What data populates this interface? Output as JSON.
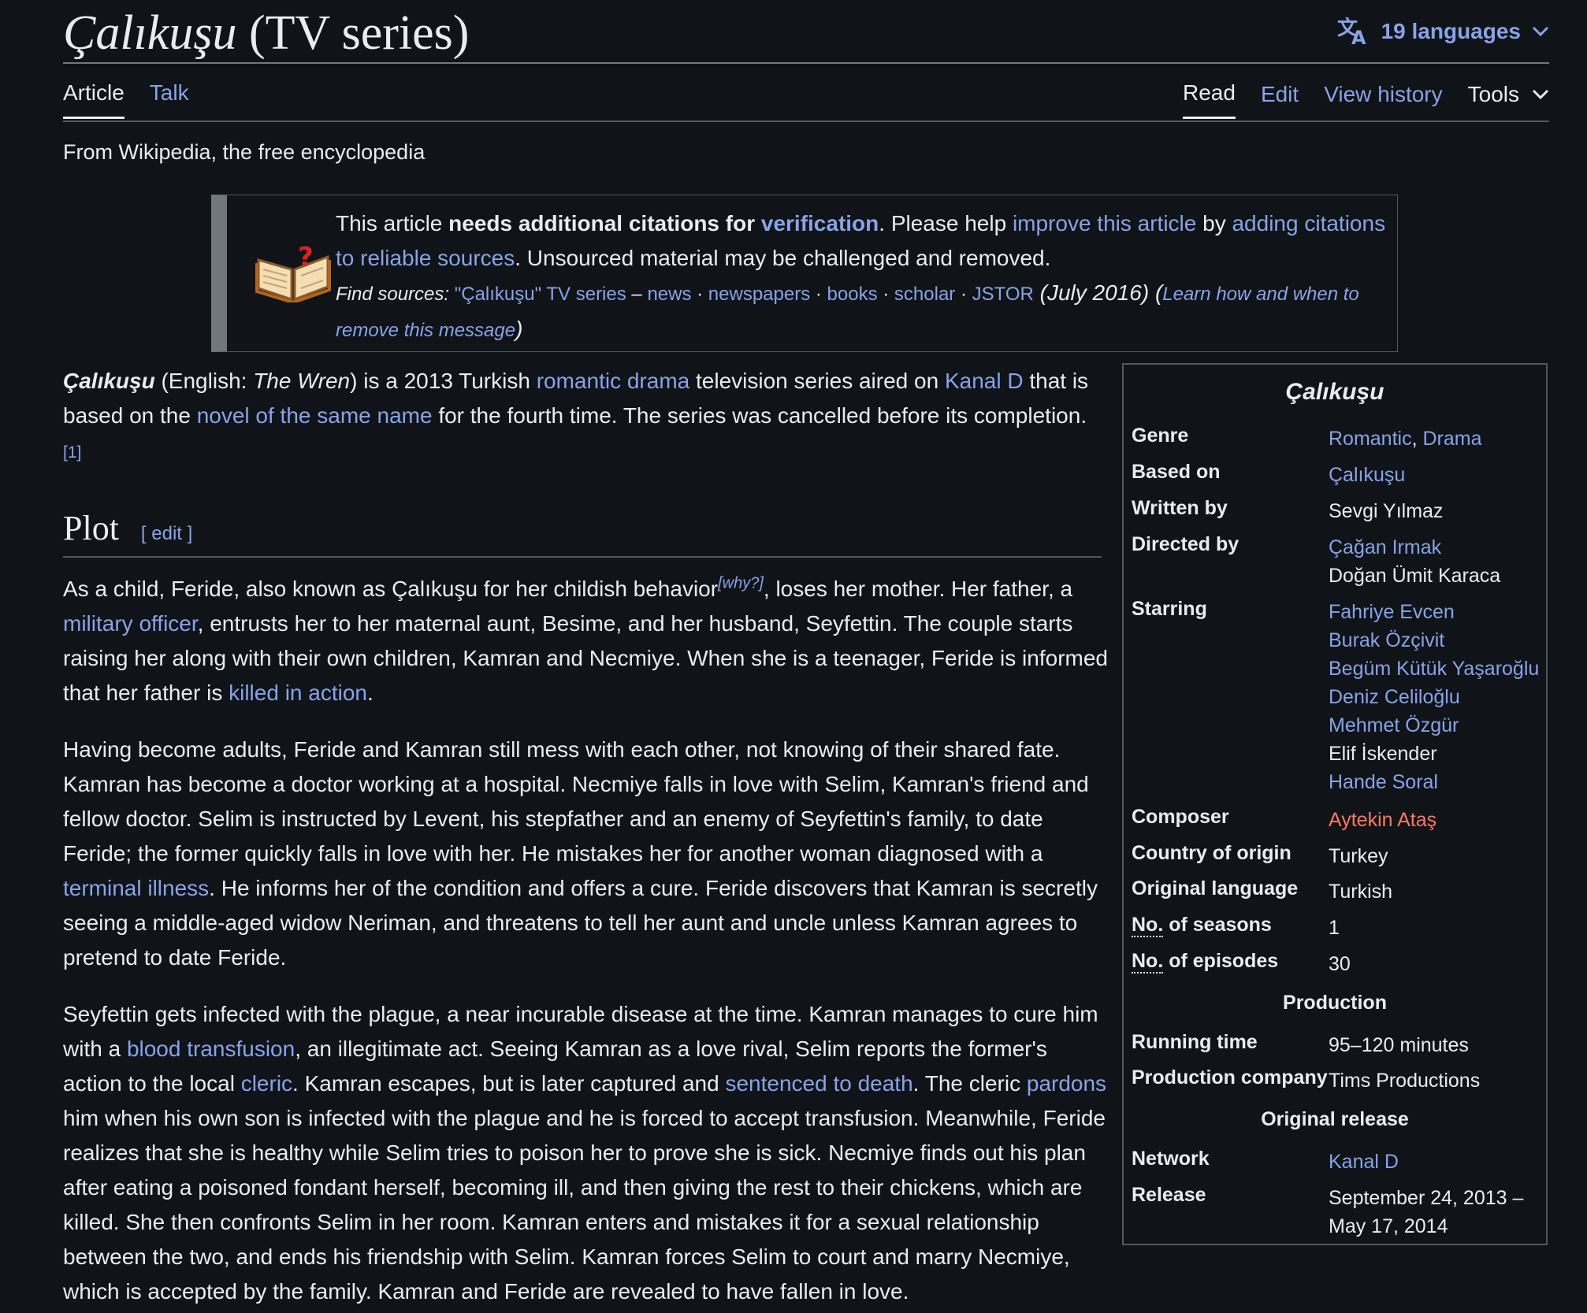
{
  "page": {
    "title_italic": "Çalıkuşu",
    "title_rest": " (TV series)",
    "languages_label": "19 languages"
  },
  "tabs": {
    "article": "Article",
    "talk": "Talk",
    "read": "Read",
    "edit": "Edit",
    "history": "View history",
    "tools": "Tools"
  },
  "from_text": "From Wikipedia, the free encyclopedia",
  "ambox": {
    "t1": "This article ",
    "t2": "needs additional citations for ",
    "t3": "verification",
    "t4": ". Please help ",
    "t5": "improve this article",
    "t6": " by ",
    "t7": "adding citations to reliable sources",
    "t8": ". Unsourced material may be challenged and removed.",
    "find": "Find sources: ",
    "q": "\"Çalıkuşu\" TV series",
    "dash": " – ",
    "news": "news",
    "dot": " · ",
    "newspapers": "newspapers",
    "books": "books",
    "scholar": "scholar",
    "jstor": "JSTOR",
    "date": " (July 2016) ",
    "open": "(",
    "learn": "Learn how and when to remove this message",
    "close": ")"
  },
  "lead": {
    "b": "Çalıkuşu",
    "t1": " (English: ",
    "i": "The Wren",
    "t2": ") is a 2013 Turkish ",
    "l1": "romantic drama",
    "t3": " television series aired on ",
    "l2": "Kanal D",
    "t4": " that is based on the ",
    "l3": "novel of the same name",
    "t5": " for the fourth time. The series was cancelled before its completion.",
    "ref": "[1]"
  },
  "plot": {
    "heading": "Plot",
    "edit": "[ edit ]",
    "p1": {
      "t1": "As a child, Feride, also known as Çalıkuşu for her childish behavior",
      "why": "[why?]",
      "t2": ", loses her mother. Her father, a ",
      "l1": "military officer",
      "t3": ", entrusts her to her maternal aunt, Besime, and her husband, Seyfettin. The couple starts raising her along with their own children, Kamran and Necmiye. When she is a teenager, Feride is informed that her father is ",
      "l2": "killed in action",
      "t4": "."
    },
    "p2": {
      "t1": "Having become adults, Feride and Kamran still mess with each other, not knowing of their shared fate. Kamran has become a doctor working at a hospital. Necmiye falls in love with Selim, Kamran's friend and fellow doctor. Selim is instructed by Levent, his stepfather and an enemy of Seyfettin's family, to date Feride; the former quickly falls in love with her. He mistakes her for another woman diagnosed with a ",
      "l1": "terminal illness",
      "t2": ". He informs her of the condition and offers a cure. Feride discovers that Kamran is secretly seeing a middle-aged widow Neriman, and threatens to tell her aunt and uncle unless Kamran agrees to pretend to date Feride."
    },
    "p3": {
      "t1": "Seyfettin gets infected with the plague, a near incurable disease at the time. Kamran manages to cure him with a ",
      "l1": "blood transfusion",
      "t2": ", an illegitimate act. Seeing Kamran as a love rival, Selim reports the former's action to the local ",
      "l2": "cleric",
      "t3": ". Kamran escapes, but is later captured and ",
      "l3": "sentenced to death",
      "t4": ". The cleric ",
      "l4": "pardons",
      "t5": " him when his own son is infected with the plague and he is forced to accept transfusion. Meanwhile, Feride realizes that she is healthy while Selim tries to poison her to prove she is sick. Necmiye finds out his plan after eating a poisoned fondant herself, becoming ill, and then giving the rest to their chickens, which are killed. She then confronts Selim in her room. Kamran enters and mistakes it for a sexual relationship between the two, and ends his friendship with Selim. Kamran forces Selim to court and marry Necmiye, which is accepted by the family. Kamran and Feride are revealed to have fallen in love."
    }
  },
  "infobox": {
    "title": "Çalıkuşu",
    "genre_label": "Genre",
    "genre_1": "Romantic",
    "genre_sep": ", ",
    "genre_2": "Drama",
    "based_label": "Based on",
    "based_val": "Çalıkuşu",
    "written_label": "Written by",
    "written_val": "Sevgi Yılmaz",
    "directed_label": "Directed by",
    "directed": [
      "Çağan Irmak",
      "Doğan Ümit Karaca"
    ],
    "starring_label": "Starring",
    "starring": [
      "Fahriye Evcen",
      "Burak Özçivit",
      "Begüm Kütük Yaşaroğlu",
      "Deniz Celiloğlu",
      "Mehmet Özgür",
      "Elif İskender",
      "Hande Soral"
    ],
    "composer_label": "Composer",
    "composer_val": "Aytekin Ataş",
    "country_label": "Country of origin",
    "country_val": "Turkey",
    "language_label": "Original language",
    "language_val": "Turkish",
    "seasons_abbr": "No.",
    "seasons_label": " of seasons",
    "seasons_val": "1",
    "episodes_abbr": "No.",
    "episodes_label": " of episodes",
    "episodes_val": "30",
    "production_head": "Production",
    "running_label": "Running time",
    "running_val": "95–120 minutes",
    "company_label": "Production company",
    "company_val": "Tims Productions",
    "release_head": "Original release",
    "network_label": "Network",
    "network_val": "Kanal D",
    "release_label": "Release",
    "release_val_1": "September 24, 2013 –",
    "release_val_2": "May 17, 2014"
  }
}
